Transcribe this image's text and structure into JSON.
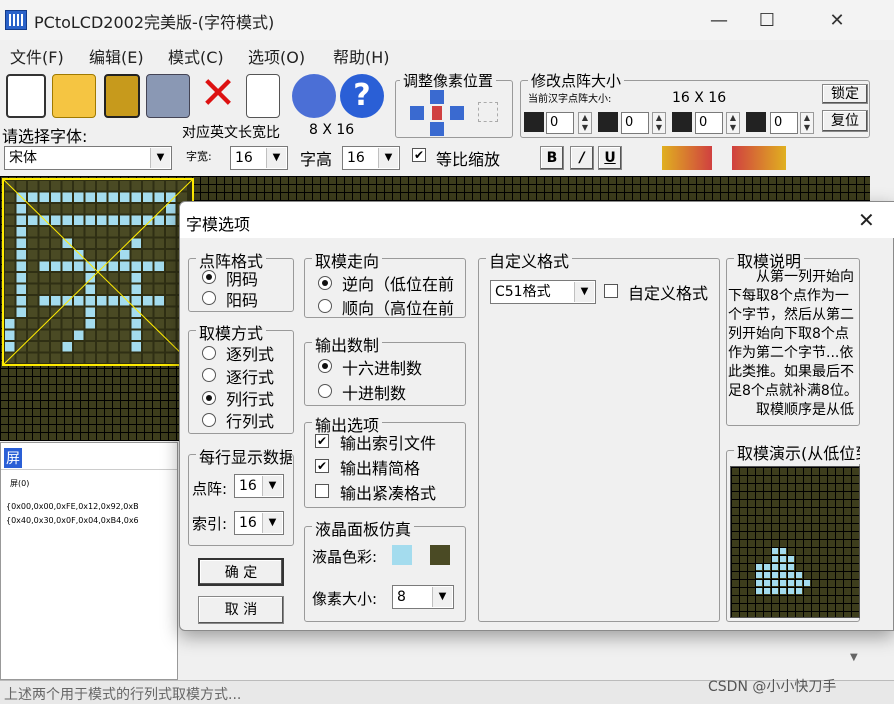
{
  "window": {
    "title": "PCtoLCD2002完美版-(字符模式)"
  },
  "menu": [
    "文件(F)",
    "编辑(E)",
    "模式(C)",
    "选项(O)",
    "帮助(H)"
  ],
  "toolbar": {
    "adjust_group": "调整像素位置",
    "resize_group": "修改点阵大小",
    "current_size_label": "当前汉字点阵大小:",
    "current_size_value": "16 X 16",
    "lock_button": "锁定",
    "reset_button": "复位",
    "spin_values": [
      "0",
      "0",
      "0",
      "0"
    ],
    "font_prompt": "请选择字体:",
    "font_value": "宋体",
    "ratio_label": "对应英文长宽比",
    "ratio_value": "8 X 16",
    "width_label": "字宽:",
    "width_value": "16",
    "height_label": "字高",
    "height_value": "16",
    "scale_label": "等比缩放",
    "scale_checked": true,
    "bold_button": "B",
    "italic_button": "/",
    "underline_button": "U"
  },
  "output": {
    "tab_char": "屏",
    "char_line": "屏(0)",
    "data_line1": "{0x00,0x00,0xFE,0x12,0x92,0xB",
    "data_line2": "{0x40,0x30,0x0F,0x04,0xB4,0x6"
  },
  "dialog": {
    "title": "字模选项",
    "close_icon": "close-icon",
    "dot_format": {
      "label": "点阵格式",
      "options": [
        "阴码",
        "阳码"
      ],
      "selected": 0
    },
    "scan_mode": {
      "label": "取模方式",
      "options": [
        "逐列式",
        "逐行式",
        "列行式",
        "行列式"
      ],
      "selected": 2
    },
    "per_line": {
      "label": "每行显示数据",
      "dot_label": "点阵:",
      "dot_value": "16",
      "index_label": "索引:",
      "index_value": "16"
    },
    "ok_button": "确   定",
    "cancel_button": "取   消",
    "direction": {
      "label": "取模走向",
      "options": [
        "逆向（低位在前",
        "顺向（高位在前"
      ],
      "selected": 0
    },
    "number_base": {
      "label": "输出数制",
      "options": [
        "十六进制数",
        "十进制数"
      ],
      "selected": 0
    },
    "output_opts": {
      "label": "输出选项",
      "items": [
        {
          "text": "输出索引文件",
          "checked": true
        },
        {
          "text": "输出精简格",
          "checked": true
        },
        {
          "text": "输出紧凑格式",
          "checked": false
        }
      ]
    },
    "lcd_sim": {
      "label": "液晶面板仿真",
      "color_label": "液晶色彩:",
      "pixel_label": "像素大小:",
      "pixel_value": "8",
      "color_on": "#a4dcee",
      "color_off": "#4a4a24"
    },
    "custom": {
      "label": "自定义格式",
      "format_value": "C51格式",
      "custom_check": "自定义格式"
    },
    "explain": {
      "label": "取模说明",
      "text": "　　从第一列开始向下每取8个点作为一个字节，然后从第二列开始向下取8个点作为第二个字节...依此类推。如果最后不足8个点就补满8位。\n　　取模顺序是从低到"
    },
    "demo": {
      "label": "取模演示(从低位到"
    }
  },
  "watermark": "CSDN @小小快刀手",
  "status_text": "上述两个用于模式的行列式取模方式..."
}
